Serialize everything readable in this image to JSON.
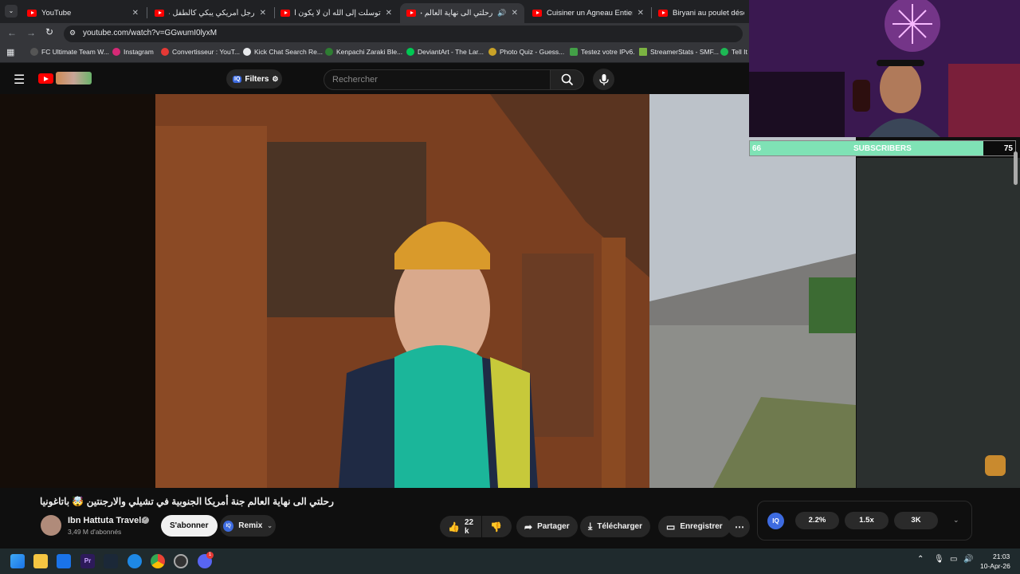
{
  "browser": {
    "tabs": [
      {
        "title": "YouTube",
        "active": false
      },
      {
        "title": "رجل أمريكي يبكي كالطفل عندما...",
        "active": false
      },
      {
        "title": "توسلت إلى الله أن لا يكون الإسلا...",
        "active": false
      },
      {
        "title": "رحلتي الى نهاية العالم جنة أم...",
        "active": true
      },
      {
        "title": "Cuisiner un Agneau Entier sous...",
        "active": false
      },
      {
        "title": "Biryani au poulet désossé sp",
        "active": false
      }
    ],
    "url": "youtube.com/watch?v=GGwumI0lyxM",
    "bookmarks": [
      {
        "label": "FC Ultimate Team W...",
        "color": "#3a3a3a"
      },
      {
        "label": "Instagram",
        "color": "#d62976"
      },
      {
        "label": "Convertisseur : YouT...",
        "color": "#e53935"
      },
      {
        "label": "Kick Chat Search Re...",
        "color": "#e8eaed"
      },
      {
        "label": "Kenpachi Zaraki Ble...",
        "color": "#2e7d32"
      },
      {
        "label": "DeviantArt - The Lar...",
        "color": "#00c853"
      },
      {
        "label": "Photo Quiz - Guess...",
        "color": "#c9a227"
      },
      {
        "label": "Testez votre IPv6.",
        "color": "#43a047"
      },
      {
        "label": "StreamerStats - SMF...",
        "color": "#7cb342"
      },
      {
        "label": "Tell It",
        "color": "#1db954"
      }
    ]
  },
  "youtube": {
    "filters_label": "Filters",
    "search_placeholder": "Rechercher",
    "video_title": "رحلتي الى نهاية العالم جنة أمريكا الجنوبية في تشيلي والارجنتين 🤯 باتاغونيا",
    "channel_name": "Ibn Hattuta Travels",
    "subscribers": "3,49 M d'abonnés",
    "subscribe_label": "S'abonner",
    "remix_label": "Remix",
    "likes": "22 k",
    "share_label": "Partager",
    "download_label": "Télécharger",
    "save_label": "Enregistrer"
  },
  "stream_overlay": {
    "sub_current": "66",
    "sub_label": "SUBSCRIBERS",
    "sub_goal": "75",
    "sub_progress": 0.88
  },
  "iq_panel": {
    "logo": "IQ",
    "buttons": [
      "2.2%",
      "1.5x",
      "3K"
    ]
  },
  "taskbar": {
    "time": "21:03",
    "date": "10-Apr-26",
    "discord_badge": "1"
  },
  "colors": {
    "youtube_red": "#ff0000",
    "sub_bar": "#7fe2b5",
    "iq_accent": "#3d6be0"
  }
}
